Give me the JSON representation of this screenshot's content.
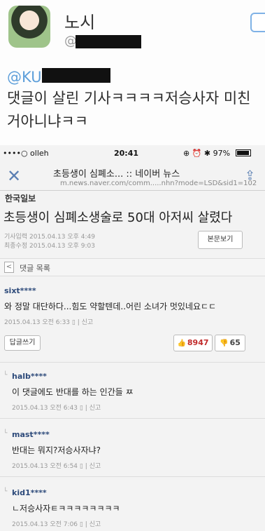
{
  "tweet": {
    "name": "노시",
    "handle": "@",
    "mention": "@KU",
    "text": "댓글이 살린 기사ㅋㅋㅋㅋ저승사자 미친거아니냐ㅋㅋ"
  },
  "status": {
    "carrier": "••••○ olleh",
    "time": "20:41",
    "right": "⊕ ⏰ ✱ 97%"
  },
  "browser": {
    "title": "초등생이 심폐소... :: 네이버 뉴스",
    "url": "m.news.naver.com/comm.....nhn?mode=LSD&sid1=102"
  },
  "article": {
    "press": "한국일보",
    "headline": "초등생이 심폐소생술로 50대 아저씨 살렸다",
    "posted": "기사입력  2015.04.13 오후 4:49",
    "modified": "최종수정  2015.04.13 오후 9:03",
    "view_button": "본문보기"
  },
  "comments_header": {
    "label": "댓글 목록",
    "back": "<"
  },
  "comments": [
    {
      "user": "sixt****",
      "text": "와 정말 대단하다...힘도 약할텐데..어린 소녀가 멋있네요ㄷㄷ",
      "meta": "2015.04.13 오전 6:33 ▯ | 신고",
      "reply_button": "답글쓰기",
      "likes": "8947",
      "dislikes": "65"
    },
    {
      "user": "halb****",
      "text": "이 댓글에도 반대를 하는 인간들 ㅉ",
      "meta": "2015.04.13 오전 6:43 ▯ | 신고"
    },
    {
      "user": "mast****",
      "text": "반대는 뭐지?저승사자냐?",
      "meta": "2015.04.13 오전 6:54 ▯ | 신고"
    },
    {
      "user": "kid1****",
      "text": "ㄴ저승사자ㅌㅋㅋㅋㅋㅋㅋㅋㅋ",
      "meta": "2015.04.13 오전 7:06 ▯ | 신고"
    }
  ]
}
